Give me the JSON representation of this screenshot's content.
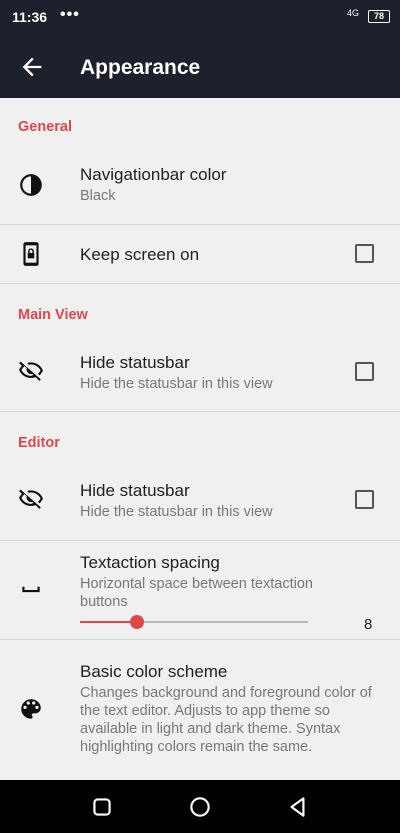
{
  "status": {
    "time": "11:36",
    "dots": "•••",
    "network": "4G",
    "battery": "78"
  },
  "appbar": {
    "title": "Appearance"
  },
  "sections": {
    "general": "General",
    "main_view": "Main View",
    "editor": "Editor"
  },
  "items": {
    "navbar_color": {
      "title": "Navigationbar color",
      "subtitle": "Black",
      "icon": "contrast-icon"
    },
    "keep_screen": {
      "title": "Keep screen on",
      "checked": false,
      "icon": "phone-lock-icon"
    },
    "main_hide_statusbar": {
      "title": "Hide statusbar",
      "subtitle": "Hide the statusbar in this view",
      "checked": false,
      "icon": "eye-off-icon"
    },
    "editor_hide_statusbar": {
      "title": "Hide statusbar",
      "subtitle": "Hide the statusbar in this view",
      "checked": false,
      "icon": "eye-off-icon"
    },
    "textaction_spacing": {
      "title": "Textaction spacing",
      "subtitle": "Horizontal space between textaction buttons",
      "value": "8",
      "slider_fraction": 0.25,
      "icon": "space-bar-icon"
    },
    "color_scheme": {
      "title": "Basic color scheme",
      "subtitle": "Changes background and foreground color of the text editor. Adjusts to app theme so available in light and dark theme. Syntax highlighting colors remain the same.",
      "icon": "palette-icon"
    }
  },
  "colors": {
    "accent": "#e0474c",
    "appbar": "#1d212b",
    "background": "#f0f0f0"
  }
}
